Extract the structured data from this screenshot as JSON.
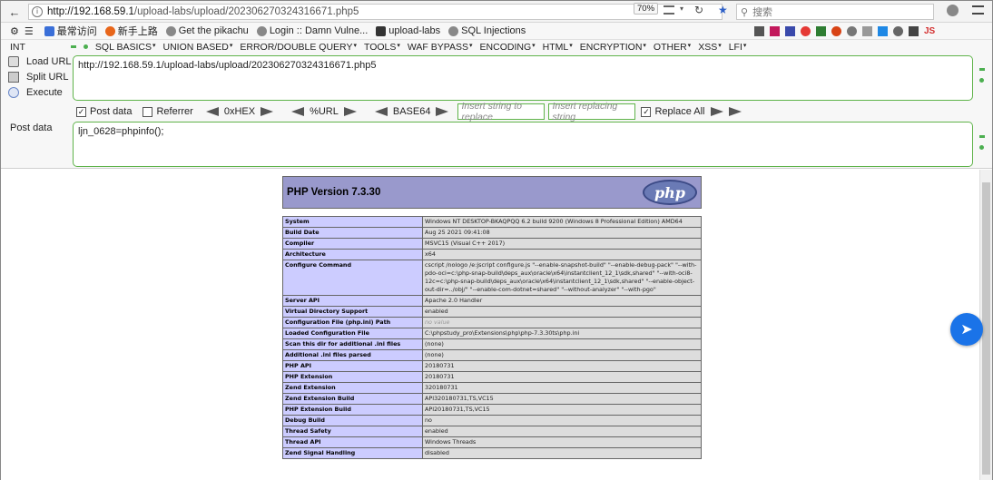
{
  "browser": {
    "url_host": "http://192.168.59.1",
    "url_path": "/upload-labs/upload/202306270324316671.php5",
    "zoom": "70%",
    "search_placeholder": "搜索"
  },
  "bookmarks": [
    {
      "label": "最常访问",
      "icon": "gear-icon",
      "color": "#3a6fd8"
    },
    {
      "label": "新手上路",
      "icon": "firefox-icon",
      "color": "#e8661a"
    },
    {
      "label": "Get the pikachu",
      "icon": "globe-icon",
      "color": "#888"
    },
    {
      "label": "Login :: Damn Vulne...",
      "icon": "globe-icon",
      "color": "#888"
    },
    {
      "label": "upload-labs",
      "icon": "folder-icon",
      "color": "#333"
    },
    {
      "label": "SQL Injections",
      "icon": "globe-icon",
      "color": "#888"
    }
  ],
  "hackbar": {
    "int_label": "INT",
    "menus": [
      "SQL BASICS",
      "UNION BASED",
      "ERROR/DOUBLE QUERY",
      "TOOLS",
      "WAF BYPASS",
      "ENCODING",
      "HTML",
      "ENCRYPTION",
      "OTHER",
      "XSS",
      "LFI"
    ],
    "load_url": "Load URL",
    "split_url": "Split URL",
    "execute": "Execute",
    "url_value": "http://192.168.59.1/upload-labs/upload/202306270324316671.php5",
    "post_data_checkbox": "Post data",
    "referrer_checkbox": "Referrer",
    "hex": "0xHEX",
    "url_enc": "%URL",
    "base64": "BASE64",
    "replace_placeholder": "Insert string to replace",
    "replacing_placeholder": "Insert replacing string",
    "replace_all": "Replace All",
    "post_label": "Post data",
    "post_value": "ljn_0628=phpinfo();"
  },
  "phpinfo": {
    "title": "PHP Version 7.3.30",
    "logo": "php",
    "rows": [
      {
        "k": "System",
        "v": "Windows NT DESKTOP-BKAQPQQ 6.2 build 9200 (Windows 8 Professional Edition) AMD64"
      },
      {
        "k": "Build Date",
        "v": "Aug 25 2021 09:41:08"
      },
      {
        "k": "Compiler",
        "v": "MSVC15 (Visual C++ 2017)"
      },
      {
        "k": "Architecture",
        "v": "x64"
      },
      {
        "k": "Configure Command",
        "v": "cscript /nologo /e:jscript configure.js \"--enable-snapshot-build\" \"--enable-debug-pack\" \"--with-pdo-oci=c:\\php-snap-build\\deps_aux\\oracle\\x64\\instantclient_12_1\\sdk,shared\" \"--with-oci8-12c=c:\\php-snap-build\\deps_aux\\oracle\\x64\\instantclient_12_1\\sdk,shared\" \"--enable-object-out-dir=../obj/\" \"--enable-com-dotnet=shared\" \"--without-analyzer\" \"--with-pgo\""
      },
      {
        "k": "Server API",
        "v": "Apache 2.0 Handler"
      },
      {
        "k": "Virtual Directory Support",
        "v": "enabled"
      },
      {
        "k": "Configuration File (php.ini) Path",
        "v": "no value",
        "nv": true
      },
      {
        "k": "Loaded Configuration File",
        "v": "C:\\phpstudy_pro\\Extensions\\php\\php-7.3.30ts\\php.ini"
      },
      {
        "k": "Scan this dir for additional .ini files",
        "v": "(none)"
      },
      {
        "k": "Additional .ini files parsed",
        "v": "(none)"
      },
      {
        "k": "PHP API",
        "v": "20180731"
      },
      {
        "k": "PHP Extension",
        "v": "20180731"
      },
      {
        "k": "Zend Extension",
        "v": "320180731"
      },
      {
        "k": "Zend Extension Build",
        "v": "API320180731,TS,VC15"
      },
      {
        "k": "PHP Extension Build",
        "v": "API20180731,TS,VC15"
      },
      {
        "k": "Debug Build",
        "v": "no"
      },
      {
        "k": "Thread Safety",
        "v": "enabled"
      },
      {
        "k": "Thread API",
        "v": "Windows Threads"
      },
      {
        "k": "Zend Signal Handling",
        "v": "disabled"
      }
    ]
  },
  "colors": {
    "accent_green": "#5fb34a",
    "php_purple": "#9999cc",
    "php_key": "#ccccff",
    "float_blue": "#1a73e8"
  }
}
